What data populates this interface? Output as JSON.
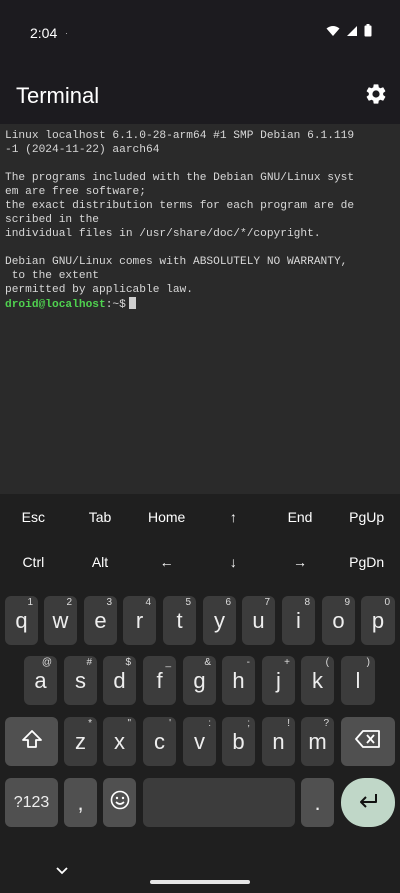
{
  "status_bar": {
    "time": "2:04",
    "notification": "·"
  },
  "app_bar": {
    "title": "Terminal"
  },
  "terminal": {
    "lines": [
      "Linux localhost 6.1.0-28-arm64 #1 SMP Debian 6.1.119",
      "-1 (2024-11-22) aarch64",
      "",
      "The programs included with the Debian GNU/Linux syst",
      "em are free software;",
      "the exact distribution terms for each program are de",
      "scribed in the",
      "individual files in /usr/share/doc/*/copyright.",
      "",
      "Debian GNU/Linux comes with ABSOLUTELY NO WARRANTY,",
      " to the extent",
      "permitted by applicable law."
    ],
    "prompt_user": "droid@localhost",
    "prompt_path": ":~$"
  },
  "extra_keys": {
    "row1": [
      "Esc",
      "Tab",
      "Home",
      "↑",
      "End",
      "PgUp"
    ],
    "row2": [
      "Ctrl",
      "Alt",
      "←",
      "↓",
      "→",
      "PgDn"
    ]
  },
  "keyboard": {
    "row1": [
      {
        "char": "q",
        "sup": "1"
      },
      {
        "char": "w",
        "sup": "2"
      },
      {
        "char": "e",
        "sup": "3"
      },
      {
        "char": "r",
        "sup": "4"
      },
      {
        "char": "t",
        "sup": "5"
      },
      {
        "char": "y",
        "sup": "6"
      },
      {
        "char": "u",
        "sup": "7"
      },
      {
        "char": "i",
        "sup": "8"
      },
      {
        "char": "o",
        "sup": "9"
      },
      {
        "char": "p",
        "sup": "0"
      }
    ],
    "row2": [
      {
        "char": "a",
        "sup": "@"
      },
      {
        "char": "s",
        "sup": "#"
      },
      {
        "char": "d",
        "sup": "$"
      },
      {
        "char": "f",
        "sup": "_"
      },
      {
        "char": "g",
        "sup": "&"
      },
      {
        "char": "h",
        "sup": "-"
      },
      {
        "char": "j",
        "sup": "+"
      },
      {
        "char": "k",
        "sup": "("
      },
      {
        "char": "l",
        "sup": ")"
      }
    ],
    "row3": [
      {
        "char": "z",
        "sup": "*"
      },
      {
        "char": "x",
        "sup": "\""
      },
      {
        "char": "c",
        "sup": "'"
      },
      {
        "char": "v",
        "sup": ":"
      },
      {
        "char": "b",
        "sup": ";"
      },
      {
        "char": "n",
        "sup": "!"
      },
      {
        "char": "m",
        "sup": "?"
      }
    ],
    "symbols_label": "?123",
    "comma": ",",
    "period": "."
  },
  "icons": {
    "settings": "gear-icon",
    "shift": "shift-arrow-icon",
    "backspace": "backspace-icon",
    "emoji": "emoji-icon",
    "enter": "enter-arrow-icon",
    "nav_back": "chevron-down-icon"
  },
  "colors": {
    "prompt_user": "#4fd14f",
    "enter_key": "#c0d7c8",
    "terminal_bg": "#2a2a2a"
  }
}
